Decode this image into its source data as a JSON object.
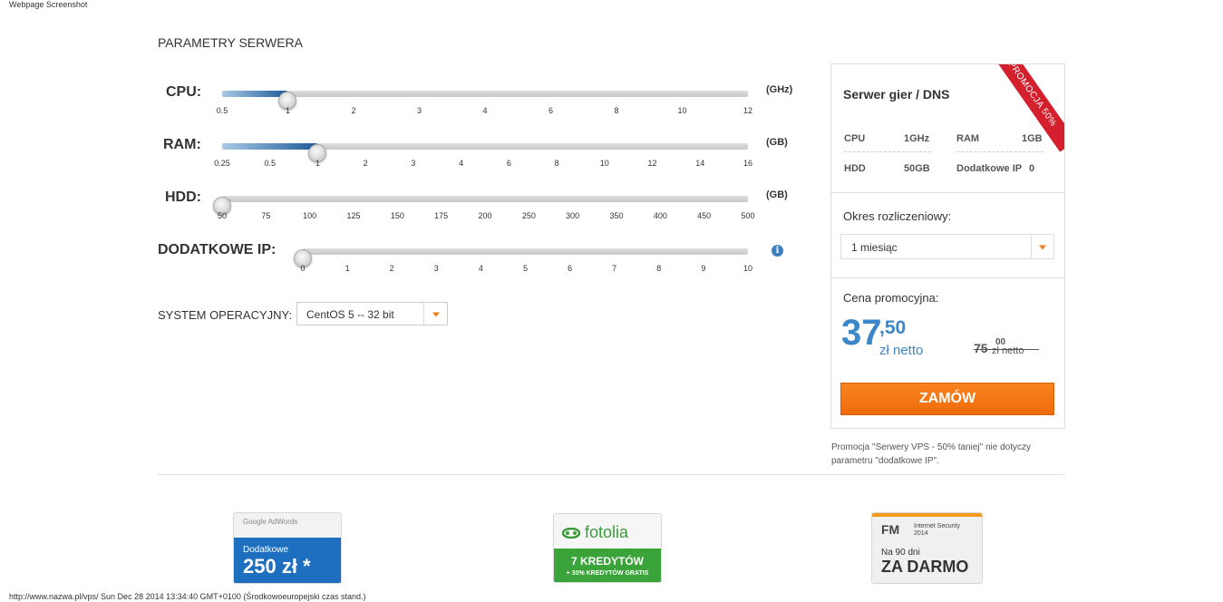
{
  "captions": {
    "top": "Webpage Screenshot",
    "bottom": "http://www.nazwa.pl/vps/ Sun Dec 28 2014 13:34:40 GMT+0100 (Środkowoeuropejski czas stand.)"
  },
  "section_title": "PARAMETRY SERWERA",
  "sliders": {
    "cpu": {
      "label": "CPU:",
      "unit": "(GHz)",
      "ticks": [
        "0.5",
        "1",
        "2",
        "3",
        "4",
        "6",
        "8",
        "10",
        "12"
      ],
      "value_index": 1
    },
    "ram": {
      "label": "RAM:",
      "unit": "(GB)",
      "ticks": [
        "0.25",
        "0.5",
        "1",
        "2",
        "3",
        "4",
        "6",
        "8",
        "10",
        "12",
        "14",
        "16"
      ],
      "value_index": 2
    },
    "hdd": {
      "label": "HDD:",
      "unit": "(GB)",
      "ticks": [
        "50",
        "75",
        "100",
        "125",
        "150",
        "175",
        "200",
        "250",
        "300",
        "350",
        "400",
        "450",
        "500"
      ],
      "value_index": 0
    },
    "ip": {
      "label": "DODATKOWE IP:",
      "ticks": [
        "0",
        "1",
        "2",
        "3",
        "4",
        "5",
        "6",
        "7",
        "8",
        "9",
        "10"
      ],
      "value_index": 0,
      "info_glyph": "i"
    }
  },
  "os": {
    "label": "SYSTEM OPERACYJNY:",
    "value": "CentOS 5 -- 32 bit"
  },
  "panel": {
    "title": "Serwer gier / DNS",
    "ribbon": "PROMOCJA 50%",
    "specs": {
      "cpu_label": "CPU",
      "cpu_value": "1GHz",
      "ram_label": "RAM",
      "ram_value": "1GB",
      "hdd_label": "HDD",
      "hdd_value": "50GB",
      "ip_label": "Dodatkowe IP",
      "ip_value": "0"
    },
    "period_label": "Okres rozliczeniowy:",
    "period_value": "1 miesiąc",
    "price_label": "Cena promocyjna:",
    "price_int": "37",
    "price_dec": ",50",
    "price_net": "zł netto",
    "old_int": "75",
    "old_dec": "00",
    "old_net": "zł netto",
    "order_button": "ZAMÓW"
  },
  "promo_note": "Promocja \"Serwery VPS - 50% taniej\" nie dotyczy parametru \"dodatkowe IP\".",
  "badges": {
    "adwords": {
      "head": "Google AdWords",
      "line1": "Dodatkowe",
      "line2": "250 zł *"
    },
    "fotolia": {
      "logo_a": "fotolia",
      "line1": "7 KREDYTÓW",
      "line2": "+ 30% KREDYTÓW GRATIS"
    },
    "fm": {
      "logo": "FM",
      "sub1": "Internet Security",
      "sub2": "2014",
      "line1": "Na 90 dni",
      "line2": "ZA DARMO"
    }
  },
  "colors": {
    "accent_orange": "#f07a1a",
    "price_blue": "#3c87c7",
    "ribbon_red": "#d41f2c"
  }
}
